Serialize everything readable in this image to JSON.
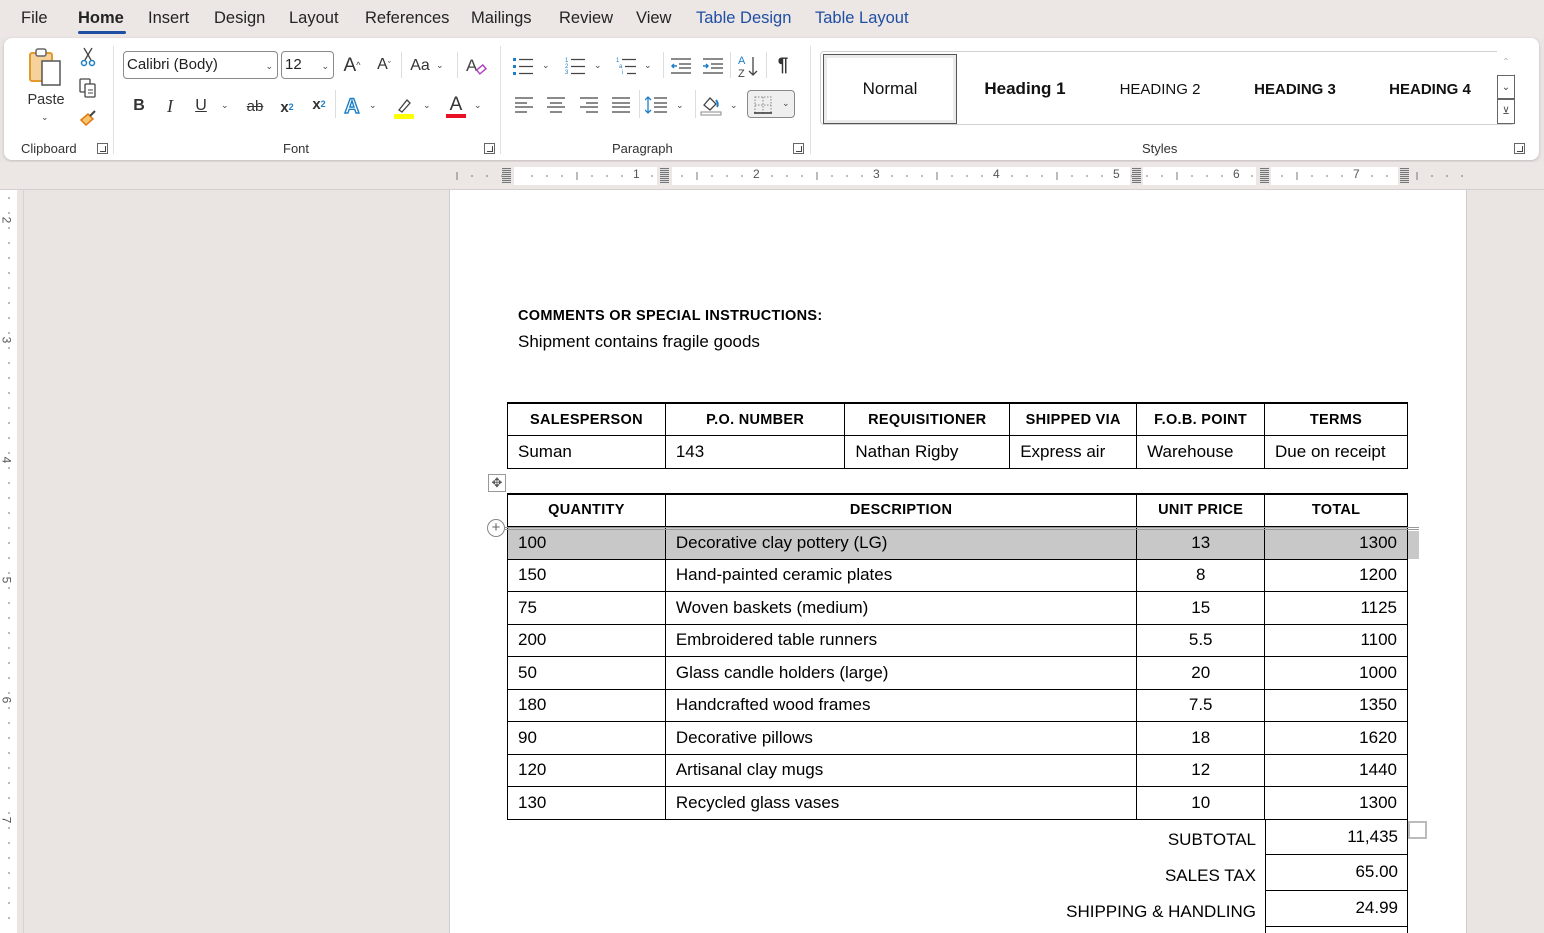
{
  "menu": {
    "tabs": [
      {
        "label": "File",
        "active": false,
        "context": false
      },
      {
        "label": "Home",
        "active": true,
        "context": false
      },
      {
        "label": "Insert",
        "active": false,
        "context": false
      },
      {
        "label": "Design",
        "active": false,
        "context": false
      },
      {
        "label": "Layout",
        "active": false,
        "context": false
      },
      {
        "label": "References",
        "active": false,
        "context": false
      },
      {
        "label": "Mailings",
        "active": false,
        "context": false
      },
      {
        "label": "Review",
        "active": false,
        "context": false
      },
      {
        "label": "View",
        "active": false,
        "context": false
      },
      {
        "label": "Table Design",
        "active": false,
        "context": true
      },
      {
        "label": "Table Layout",
        "active": false,
        "context": true
      }
    ],
    "accent_color": "#1f4fa3"
  },
  "ribbon": {
    "clipboard": {
      "label": "Clipboard",
      "paste_label": "Paste",
      "icons": [
        "paste-icon",
        "cut-icon",
        "copy-icon",
        "format-painter-icon"
      ]
    },
    "font": {
      "label": "Font",
      "font_name": "Calibri (Body)",
      "font_size": "12",
      "buttons": [
        "grow-font",
        "shrink-font",
        "change-case",
        "clear-formatting",
        "bold",
        "italic",
        "underline",
        "strikethrough",
        "subscript",
        "superscript",
        "text-effects",
        "highlight",
        "font-color"
      ],
      "highlight_color": "#ffff00",
      "font_color": "#e81123"
    },
    "paragraph": {
      "label": "Paragraph",
      "buttons": [
        "bullets",
        "numbering",
        "multilevel-list",
        "decrease-indent",
        "increase-indent",
        "sort",
        "show-formatting",
        "align-left",
        "center",
        "align-right",
        "justify",
        "line-spacing",
        "shading",
        "borders"
      ]
    },
    "styles": {
      "label": "Styles",
      "items": [
        "Normal",
        "Heading 1",
        "HEADING 2",
        "HEADING 3",
        "HEADING 4"
      ],
      "selected": "Normal"
    }
  },
  "ruler": {
    "horizontal_numbers": [
      "1",
      "2",
      "3",
      "4",
      "5",
      "6",
      "7"
    ],
    "vertical_numbers": [
      "2",
      "3",
      "4",
      "5",
      "6",
      "7"
    ]
  },
  "document": {
    "comments_label": "COMMENTS OR SPECIAL INSTRUCTIONS:",
    "comments_text": "Shipment contains fragile goods",
    "info_table": {
      "headers": [
        "SALESPERSON",
        "P.O. NUMBER",
        "REQUISITIONER",
        "SHIPPED VIA",
        "F.O.B. POINT",
        "TERMS"
      ],
      "row": [
        "Suman",
        "143",
        "Nathan Rigby",
        "Express air",
        "Warehouse",
        "Due on receipt"
      ]
    },
    "items_table": {
      "headers": [
        "QUANTITY",
        "DESCRIPTION",
        "UNIT PRICE",
        "TOTAL"
      ],
      "rows": [
        {
          "quantity": "100",
          "description": "Decorative clay pottery (LG)",
          "unit_price": "13",
          "total": "1300",
          "selected": true
        },
        {
          "quantity": "150",
          "description": "Hand-painted ceramic plates",
          "unit_price": "8",
          "total": "1200"
        },
        {
          "quantity": "75",
          "description": "Woven baskets (medium)",
          "unit_price": "15",
          "total": "1125"
        },
        {
          "quantity": "200",
          "description": "Embroidered table runners",
          "unit_price": "5.5",
          "total": "1100"
        },
        {
          "quantity": "50",
          "description": "Glass candle holders (large)",
          "unit_price": "20",
          "total": "1000"
        },
        {
          "quantity": "180",
          "description": "Handcrafted wood frames",
          "unit_price": "7.5",
          "total": "1350"
        },
        {
          "quantity": "90",
          "description": "Decorative pillows",
          "unit_price": "18",
          "total": "1620"
        },
        {
          "quantity": "120",
          "description": "Artisanal clay mugs",
          "unit_price": "12",
          "total": "1440"
        },
        {
          "quantity": "130",
          "description": "Recycled glass vases",
          "unit_price": "10",
          "total": "1300"
        }
      ]
    },
    "totals": [
      {
        "label": "SUBTOTAL",
        "value": "11,435"
      },
      {
        "label": "SALES TAX",
        "value": "65.00"
      },
      {
        "label": "SHIPPING & HANDLING",
        "value": "24.99"
      }
    ]
  }
}
